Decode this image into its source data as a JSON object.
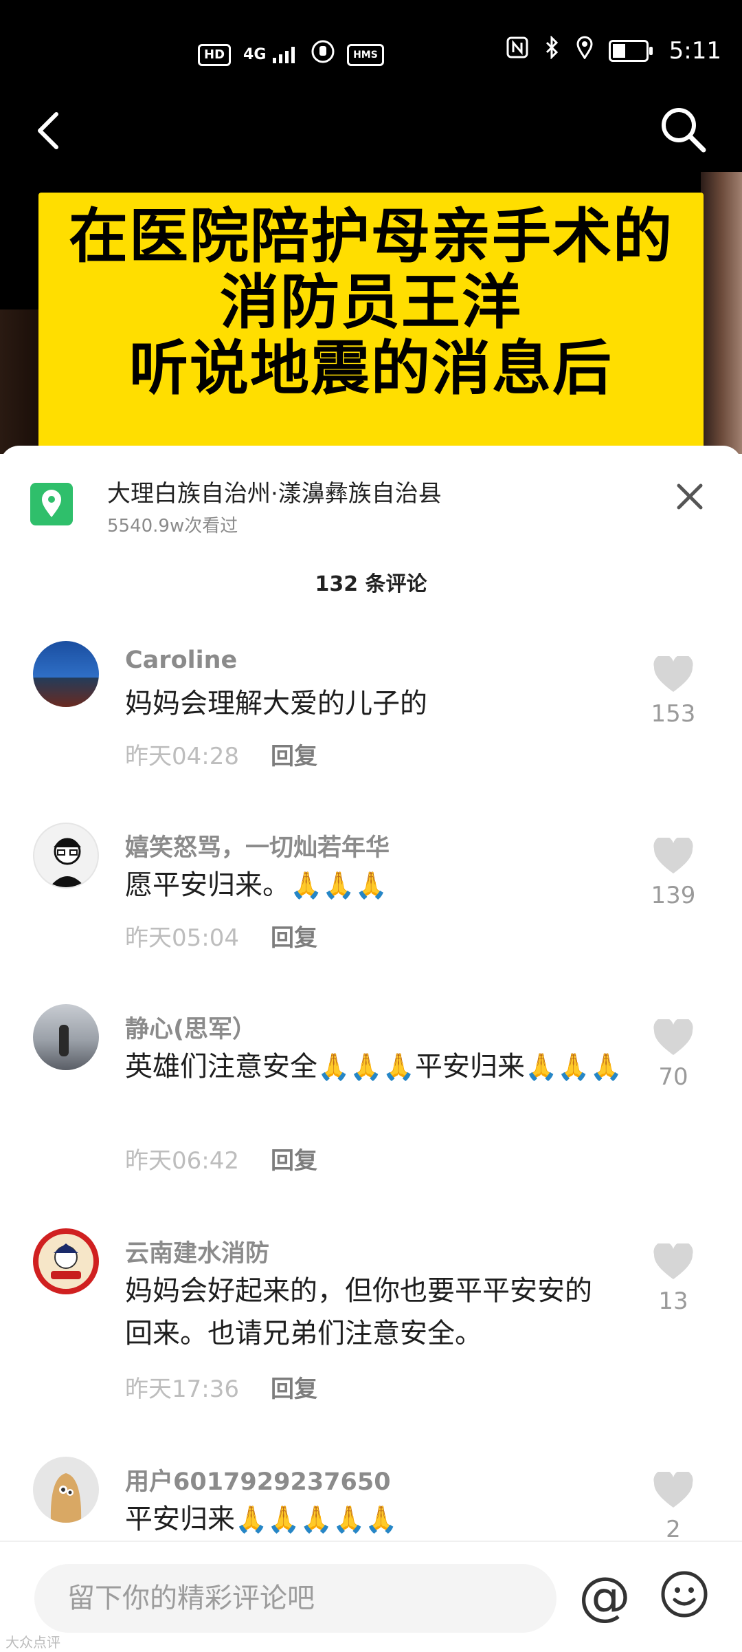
{
  "status": {
    "time": "5:11",
    "network_badges": [
      "HD",
      "4G",
      "HMS"
    ]
  },
  "video": {
    "banner_lines": [
      "在医院陪护母亲手术的",
      "消防员王洋",
      "听说地震的消息后"
    ]
  },
  "location": {
    "name": "大理白族自治州·漾濞彝族自治县",
    "views": "5540.9w次看过"
  },
  "comments_header": "132 条评论",
  "comments": [
    {
      "user": "Caroline",
      "text": "妈妈会理解大爱的儿子的",
      "time": "昨天04:28",
      "reply": "回复",
      "likes": "153"
    },
    {
      "user": "嬉笑怒骂，一切灿若年华",
      "text": "愿平安归来。",
      "time": "昨天05:04",
      "reply": "回复",
      "likes": "139"
    },
    {
      "user": "静心(思军）",
      "text": "英雄们注意安全",
      "text2": "平安归来",
      "time": "昨天06:42",
      "reply": "回复",
      "likes": "70"
    },
    {
      "user": "云南建水消防",
      "text": "妈妈会好起来的，但你也要平平安安的回来。也请兄弟们注意安全。",
      "time": "昨天17:36",
      "reply": "回复",
      "likes": "13"
    },
    {
      "user": "用户6017929237650",
      "text": "平安归来",
      "time": "",
      "reply": "",
      "likes": "2"
    }
  ],
  "input": {
    "placeholder": "留下你的精彩评论吧"
  },
  "colors": {
    "banner": "#ffde00",
    "location_icon": "#2fbf6b"
  },
  "watermark": "大众点评"
}
